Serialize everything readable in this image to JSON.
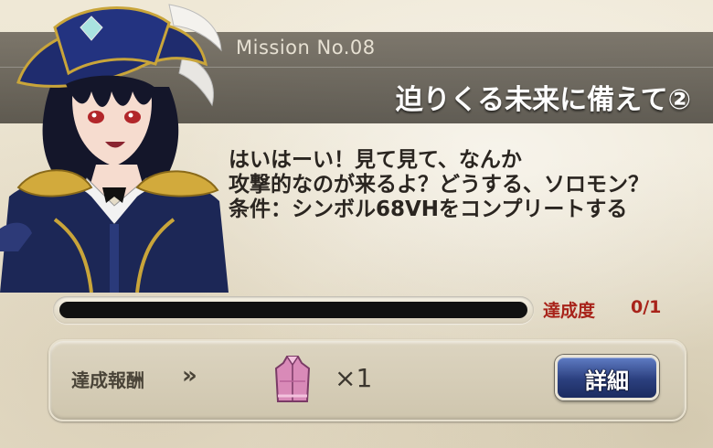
{
  "mission": {
    "number_label": "Mission No.08",
    "title": "迫りくる未来に備えて②"
  },
  "dialogue": {
    "lines": [
      "はいはーい！見て見て、なんか",
      "攻撃的なのが来るよ？どうする、ソロモン？",
      "条件：シンボル68VHをコンプリートする"
    ]
  },
  "progress": {
    "label": "達成度",
    "value_text": "0/1",
    "fraction": 0
  },
  "reward": {
    "label": "達成報酬",
    "arrows": "»",
    "item_icon": "robe-icon",
    "quantity": "×1",
    "detail_button": "詳細"
  },
  "character": {
    "icon": "pirate-character-portrait"
  },
  "colors": {
    "progress_text": "#a8231a",
    "button_blue": "#2b3f7e",
    "robe_pink": "#d98ab8"
  }
}
